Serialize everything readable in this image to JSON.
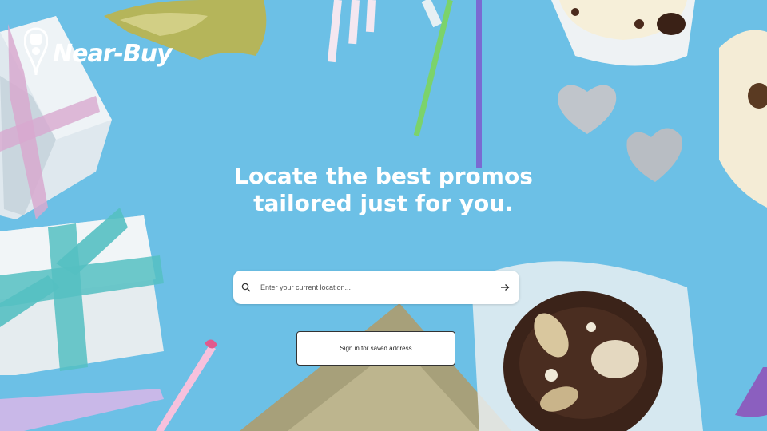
{
  "brand": {
    "name": "Near-Buy"
  },
  "hero": {
    "headline_line1": "Locate the best promos",
    "headline_line2": "tailored just for you."
  },
  "search": {
    "placeholder": "Enter your current location...",
    "value": ""
  },
  "signin": {
    "label": "Sign in for saved address"
  },
  "colors": {
    "background": "#6cc0e6",
    "accent": "#ffffff"
  },
  "icons": {
    "search": "search-icon",
    "submit": "arrow-right-icon",
    "logo": "map-pin-icon"
  }
}
